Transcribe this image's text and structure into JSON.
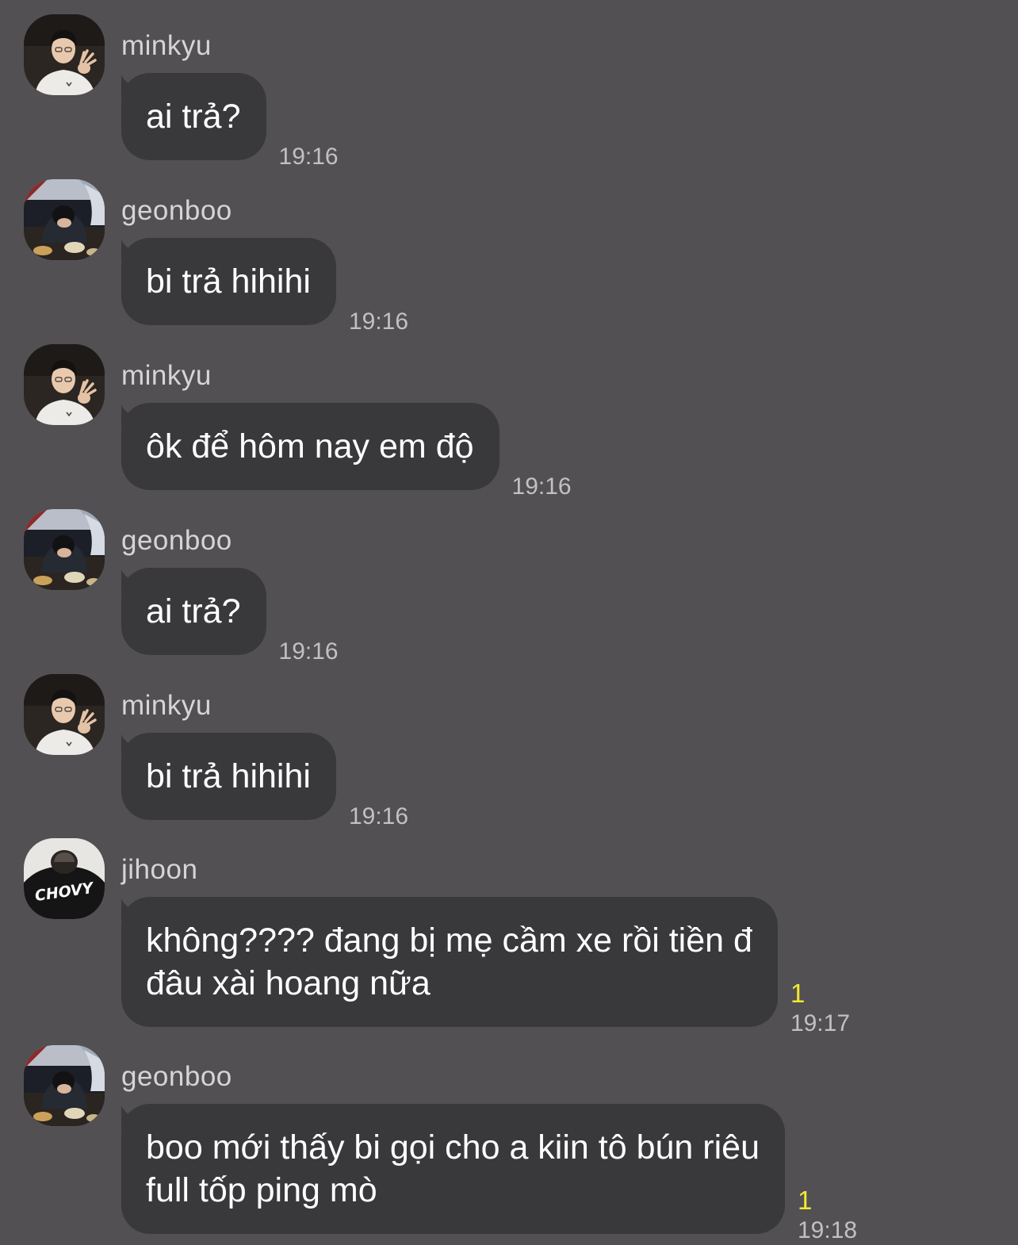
{
  "colors": {
    "background": "#525053",
    "bubble": "#39383b",
    "message_text": "#ffffff",
    "sender_text": "#d6d4d7",
    "timestamp_text": "#c2c0c4",
    "unread_count": "#f2e830"
  },
  "messages": [
    {
      "sender": "minkyu",
      "avatar": "minkyu",
      "lines": [
        "ai trả?"
      ],
      "time": "19:16",
      "unread": ""
    },
    {
      "sender": "geonboo",
      "avatar": "geonboo",
      "lines": [
        "bi trả hihihi"
      ],
      "time": "19:16",
      "unread": ""
    },
    {
      "sender": "minkyu",
      "avatar": "minkyu",
      "lines": [
        "ôk để hôm nay em độ"
      ],
      "time": "19:16",
      "unread": ""
    },
    {
      "sender": "geonboo",
      "avatar": "geonboo",
      "lines": [
        "ai trả?"
      ],
      "time": "19:16",
      "unread": ""
    },
    {
      "sender": "minkyu",
      "avatar": "minkyu",
      "lines": [
        "bi trả hihihi"
      ],
      "time": "19:16",
      "unread": ""
    },
    {
      "sender": "jihoon",
      "avatar": "jihoon",
      "lines": [
        "không???? đang bị mẹ cầm xe rồi tiền đ",
        "đâu xài hoang nữa"
      ],
      "time": "19:17",
      "unread": "1"
    },
    {
      "sender": "geonboo",
      "avatar": "geonboo",
      "lines": [
        "boo mới thấy bi gọi cho a kiin tô bún riêu",
        "full tốp ping mò"
      ],
      "time": "19:18",
      "unread": "1"
    }
  ],
  "avatars": {
    "minkyu": {
      "label": "minkyu-avatar",
      "logo_text": ""
    },
    "geonboo": {
      "label": "geonboo-avatar",
      "logo_text": ""
    },
    "jihoon": {
      "label": "jihoon-avatar",
      "logo_text": "CHOVY"
    }
  }
}
